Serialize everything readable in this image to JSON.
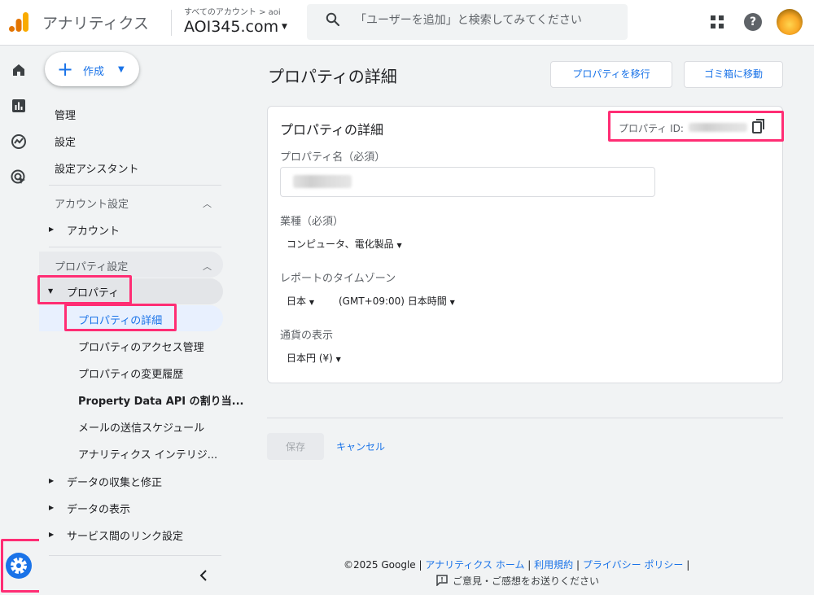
{
  "header": {
    "app_title": "アナリティクス",
    "account_breadcrumb": "すべてのアカウント > aoi",
    "account_name": "AOI345.com",
    "search_placeholder": "「ユーザーを追加」と検索してみてください"
  },
  "rail": {
    "icons": [
      "home-icon",
      "reports-icon",
      "explore-icon",
      "advertising-icon"
    ],
    "settings_icon": "gear-icon"
  },
  "sidebar": {
    "create_label": "作成",
    "top_items": [
      "管理",
      "設定",
      "設定アシスタント"
    ],
    "account_section": "アカウント設定",
    "account_item": "アカウント",
    "property_section": "プロパティ設定",
    "property_item": "プロパティ",
    "property_children": [
      "プロパティの詳細",
      "プロパティのアクセス管理",
      "プロパティの変更履歴",
      "Property Data API の割り当...",
      "メールの送信スケジュール",
      "アナリティクス インテリジ..."
    ],
    "bottom_items": [
      "データの収集と修正",
      "データの表示",
      "サービス間のリンク設定"
    ]
  },
  "main": {
    "title": "プロパティの詳細",
    "move_button": "プロパティを移行",
    "trash_button": "ゴミ箱に移動",
    "card": {
      "title": "プロパティの詳細",
      "property_id_label": "プロパティ ID:",
      "name_label": "プロパティ名（必須）",
      "industry_label": "業種（必須）",
      "industry_value": "コンピュータ、電化製品",
      "timezone_label": "レポートのタイムゾーン",
      "timezone_country": "日本",
      "timezone_value": "(GMT+09:00) 日本時間",
      "currency_label": "通貨の表示",
      "currency_value": "日本円 (¥)"
    },
    "save_label": "保存",
    "cancel_label": "キャンセル"
  },
  "footer": {
    "copyright": "©2025 Google",
    "links": [
      "アナリティクス ホーム",
      "利用規約",
      "プライバシー ポリシー"
    ],
    "feedback": "ご意見・ご感想をお送りください"
  },
  "colors": {
    "accent": "#1a73e8",
    "highlight": "#ff2d74",
    "logo_orange": "#f9ab00",
    "logo_dark_orange": "#e37400"
  }
}
